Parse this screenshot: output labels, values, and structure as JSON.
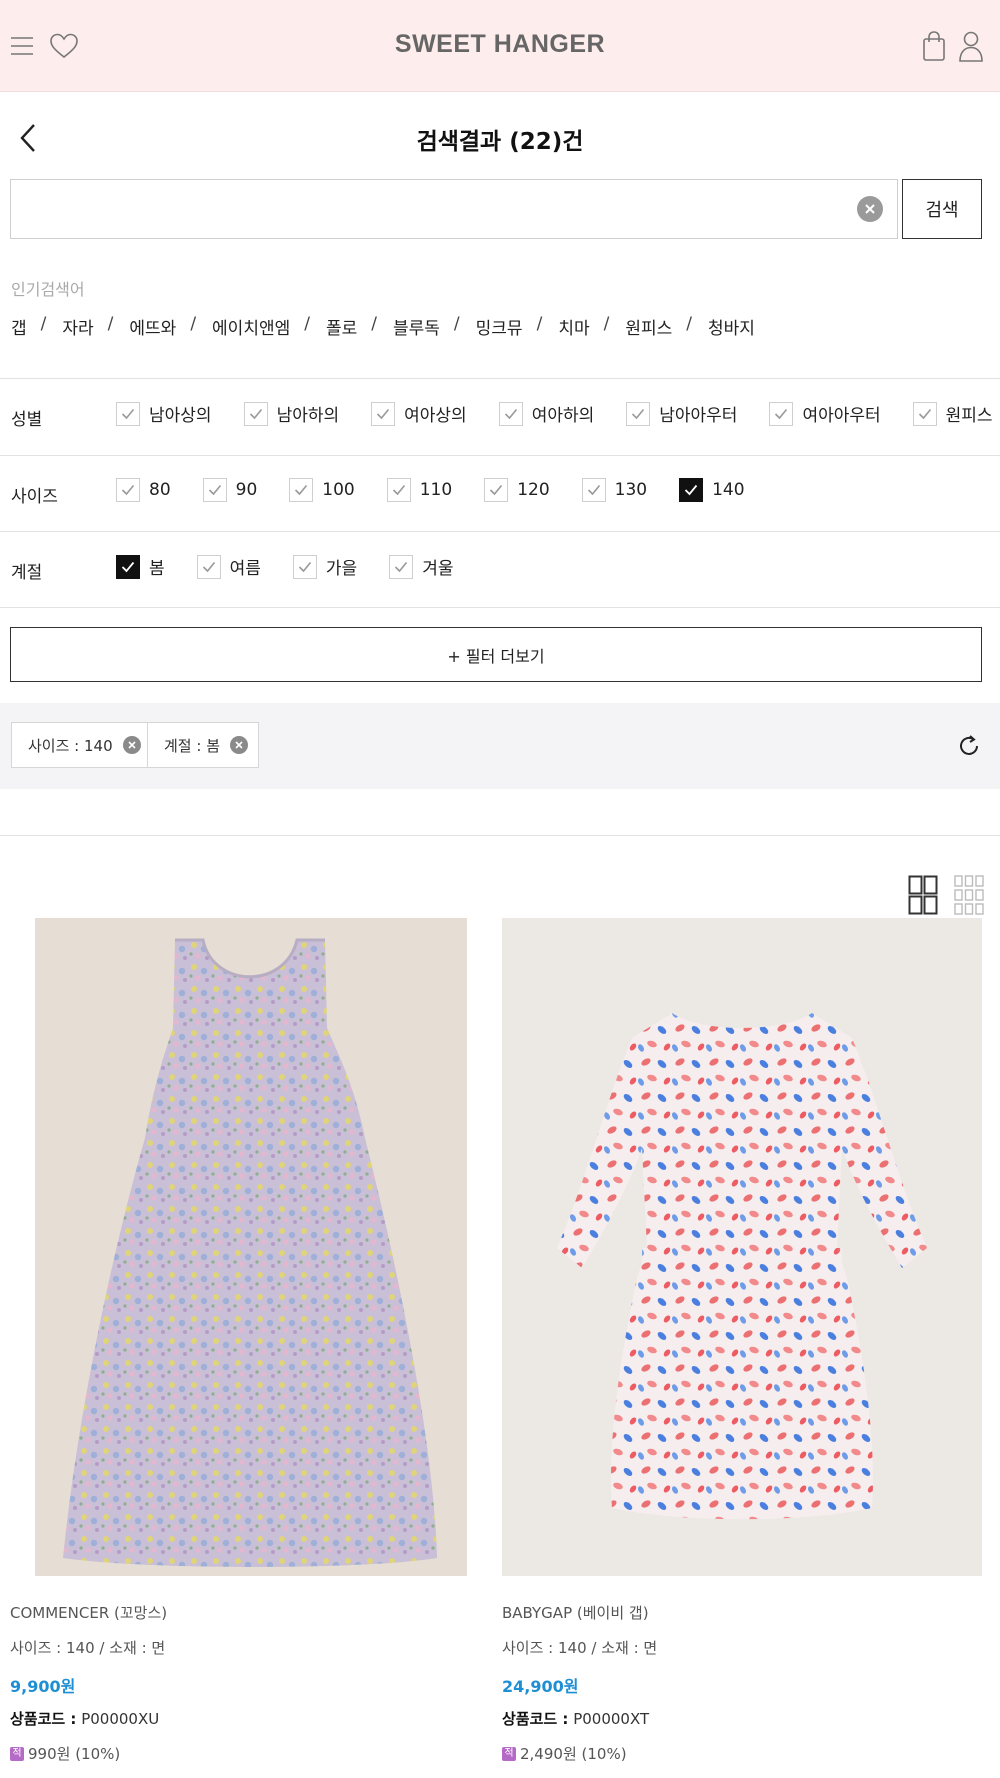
{
  "header": {
    "logo": "SWEET HANGER",
    "icons": [
      "menu-icon",
      "heart-icon",
      "shopping-bag-icon",
      "user-icon"
    ],
    "background": "#fdeeed"
  },
  "page": {
    "title": "검색결과 (22)건"
  },
  "search": {
    "value": "",
    "placeholder": "",
    "button_label": "검색"
  },
  "popular": {
    "label": "인기검색어",
    "keywords": [
      "갭",
      "자라",
      "에뜨와",
      "에이치앤엠",
      "폴로",
      "블루독",
      "밍크뮤",
      "치마",
      "원피스",
      "청바지"
    ]
  },
  "filters": {
    "gender": {
      "label": "성별",
      "options": [
        {
          "label": "남아상의",
          "checked": false
        },
        {
          "label": "남아하의",
          "checked": false
        },
        {
          "label": "여아상의",
          "checked": false
        },
        {
          "label": "여아하의",
          "checked": false
        },
        {
          "label": "남아아우터",
          "checked": false
        },
        {
          "label": "여아아우터",
          "checked": false
        },
        {
          "label": "원피스",
          "checked": false
        }
      ]
    },
    "size": {
      "label": "사이즈",
      "options": [
        {
          "label": "80",
          "checked": false
        },
        {
          "label": "90",
          "checked": false
        },
        {
          "label": "100",
          "checked": false
        },
        {
          "label": "110",
          "checked": false
        },
        {
          "label": "120",
          "checked": false
        },
        {
          "label": "130",
          "checked": false
        },
        {
          "label": "140",
          "checked": true
        }
      ]
    },
    "season": {
      "label": "계절",
      "options": [
        {
          "label": "봄",
          "checked": true
        },
        {
          "label": "여름",
          "checked": false
        },
        {
          "label": "가을",
          "checked": false
        },
        {
          "label": "겨울",
          "checked": false
        }
      ]
    },
    "more_label": "+ 필터 더보기"
  },
  "active_filters": [
    {
      "label": "사이즈 : 140"
    },
    {
      "label": "계절 : 봄"
    }
  ],
  "view_modes": [
    "grid-2-icon",
    "grid-3-icon"
  ],
  "products": [
    {
      "brand": "COMMENCER (꼬망스)",
      "size_material": "사이즈 : 140 / 소재 : 면",
      "price": "9,900원",
      "code_label": "상품코드 :",
      "code": "P00000XU",
      "point_icon": "적",
      "point": "990원 (10%)"
    },
    {
      "brand": "BABYGAP (베이비 갭)",
      "size_material": "사이즈 : 140 / 소재 : 면",
      "price": "24,900원",
      "code_label": "상품코드 :",
      "code": "P00000XT",
      "point_icon": "적",
      "point": "2,490원 (10%)"
    }
  ],
  "colors": {
    "accent_price": "#1e8fd3",
    "checked": "#111111",
    "point_badge": "#b46bc6"
  }
}
